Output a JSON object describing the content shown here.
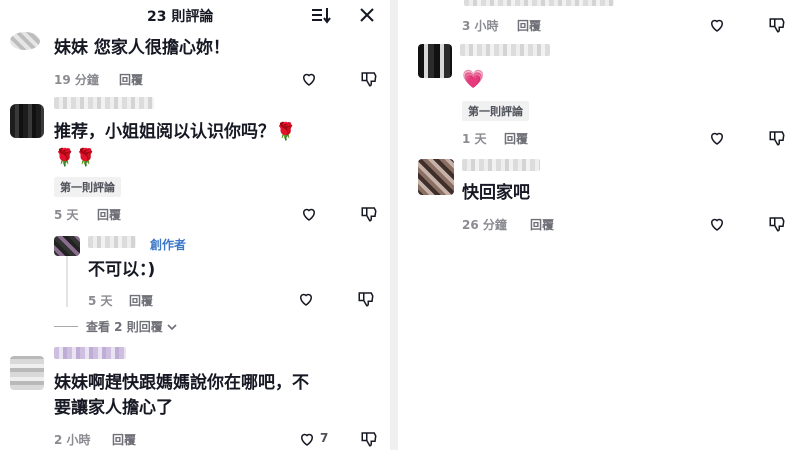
{
  "header": {
    "title": "23 則評論"
  },
  "left_comments": [
    {
      "text": "妹妹 您家人很擔心妳！",
      "time": "19 分鐘",
      "reply": "回覆"
    },
    {
      "text_line1": "推荐，小姐姐阅以认识你吗？🌹",
      "text_line2": "🌹🌹",
      "tag": "第一則評論",
      "time": "5 天",
      "reply": "回覆"
    },
    {
      "creator": "創作者",
      "text": "不可以：)",
      "time": "5 天",
      "reply": "回覆"
    },
    {
      "view_replies": "查看 2 則回覆"
    },
    {
      "text_line1": "妹妹啊趕快跟媽媽說你在哪吧，不",
      "text_line2": "要讓家人擔心了",
      "time": "2 小時",
      "reply": "回覆",
      "likes": "7"
    }
  ],
  "right_comments": [
    {
      "time": "3 小時",
      "reply": "回覆"
    },
    {
      "text": "💗",
      "tag": "第一則評論",
      "time": "1 天",
      "reply": "回覆"
    },
    {
      "text": "快回家吧",
      "time": "26 分鐘",
      "reply": "回覆"
    }
  ],
  "icons": {
    "sort": "sort-icon",
    "close": "close-icon",
    "heart": "heart-icon",
    "dislike": "dislike-icon",
    "chevron": "chevron-down-icon"
  },
  "colors": {
    "creator": "#3d78c6",
    "meta": "#8a8b91",
    "text": "#161823"
  }
}
